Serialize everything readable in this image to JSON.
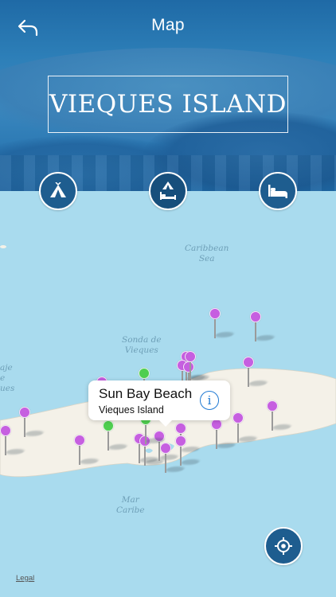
{
  "nav": {
    "title": "Map",
    "back_icon": "back-arrow-icon"
  },
  "header": {
    "banner_title": "VIEQUES ISLAND"
  },
  "categories": [
    {
      "name": "camping",
      "icon": "tent-icon",
      "active": false
    },
    {
      "name": "camping-lodging",
      "icon": "tent-bed-icon",
      "active": true
    },
    {
      "name": "lodging",
      "icon": "bed-icon",
      "active": false
    }
  ],
  "map": {
    "labels": {
      "caribbean_sea": "Caribbean\nSea",
      "sonda": "Sonda de\nVieques",
      "pasaje": "aje\ne\nues",
      "mar_caribe": "Mar\nCaribe"
    },
    "colors": {
      "water": "#a9dbee",
      "land": "#f4f1e8",
      "pin_purple": "#c65fe0",
      "pin_green": "#4fce4f",
      "button": "#1e5d8f"
    },
    "callout": {
      "title": "Sun Bay Beach",
      "subtitle": "Vieques Island"
    },
    "legal": "Legal"
  }
}
